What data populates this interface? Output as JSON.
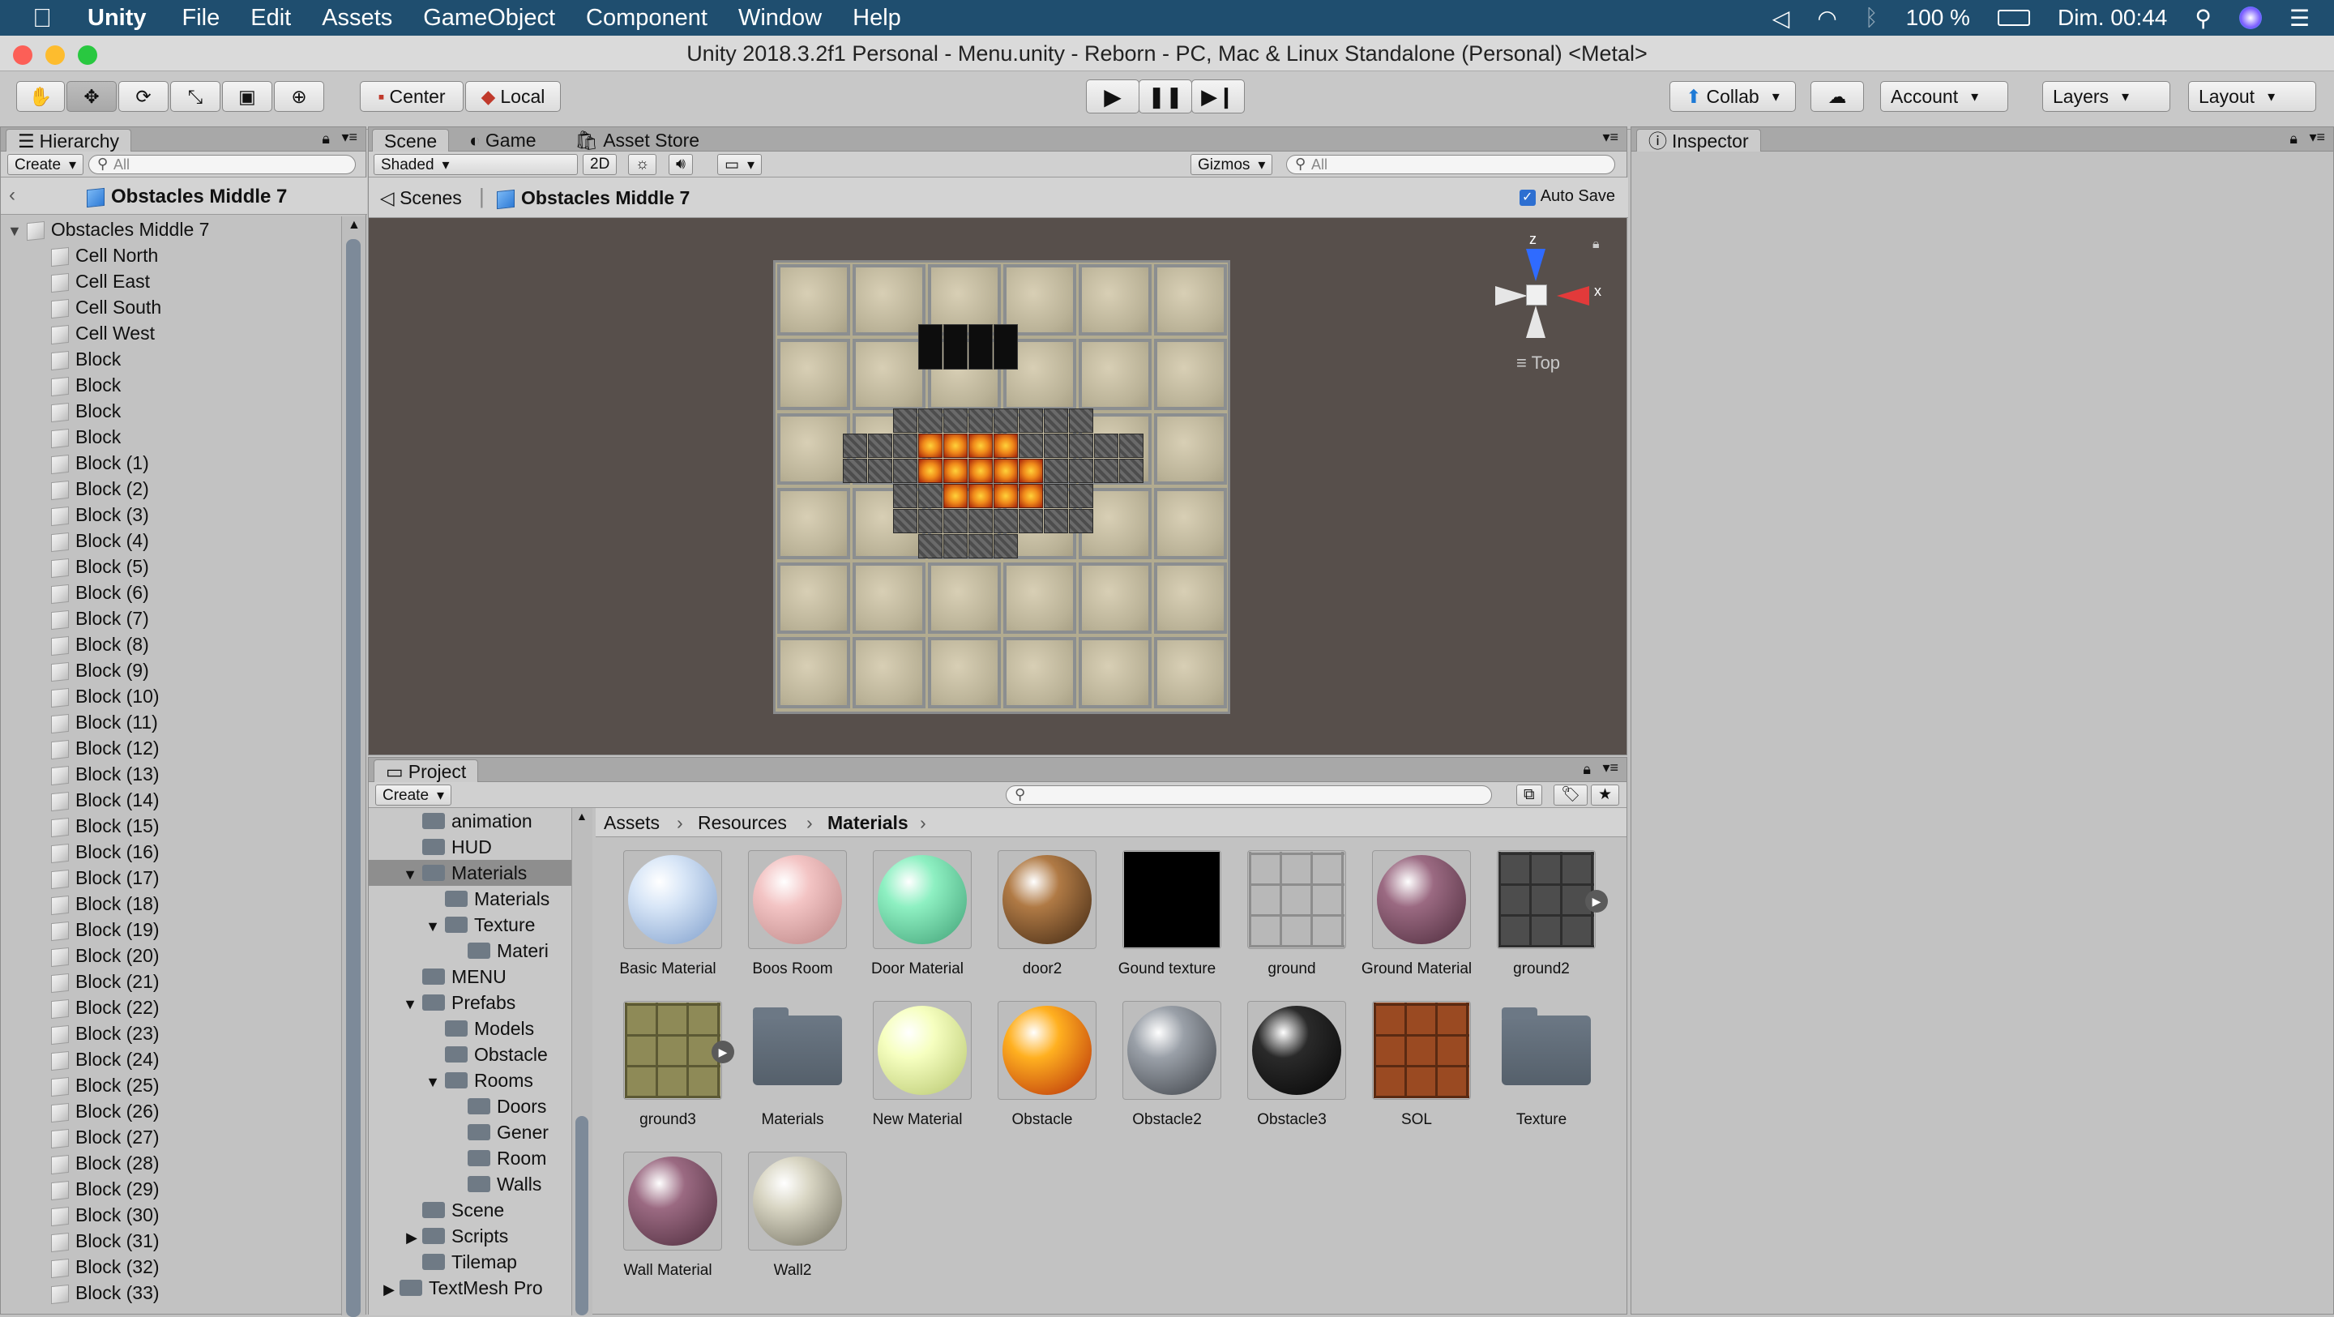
{
  "menubar": {
    "app": "Unity",
    "items": [
      "File",
      "Edit",
      "Assets",
      "GameObject",
      "Component",
      "Window",
      "Help"
    ],
    "battery": "100 %",
    "clock": "Dim. 00:44"
  },
  "window_title": "Unity 2018.3.2f1 Personal - Menu.unity - Reborn - PC, Mac & Linux Standalone (Personal) <Metal>",
  "toolbar": {
    "center": "Center",
    "local": "Local",
    "collab": "Collab",
    "account": "Account",
    "layers": "Layers",
    "layout": "Layout"
  },
  "hierarchy": {
    "tab": "Hierarchy",
    "create": "Create",
    "search_placeholder": "All",
    "breadcrumb": "Obstacles Middle 7",
    "root": "Obstacles Middle 7",
    "items": [
      "Cell North",
      "Cell East",
      "Cell South",
      "Cell West",
      "Block",
      "Block",
      "Block",
      "Block",
      "Block (1)",
      "Block (2)",
      "Block (3)",
      "Block (4)",
      "Block (5)",
      "Block (6)",
      "Block (7)",
      "Block (8)",
      "Block (9)",
      "Block (10)",
      "Block (11)",
      "Block (12)",
      "Block (13)",
      "Block (14)",
      "Block (15)",
      "Block (16)",
      "Block (17)",
      "Block (18)",
      "Block (19)",
      "Block (20)",
      "Block (21)",
      "Block (22)",
      "Block (23)",
      "Block (24)",
      "Block (25)",
      "Block (26)",
      "Block (27)",
      "Block (28)",
      "Block (29)",
      "Block (30)",
      "Block (31)",
      "Block (32)",
      "Block (33)"
    ]
  },
  "scene": {
    "tabs": [
      "Scene",
      "Game",
      "Asset Store"
    ],
    "shading": "Shaded",
    "mode2d": "2D",
    "gizmos": "Gizmos",
    "search_placeholder": "All",
    "breadcrumb_scenes": "Scenes",
    "breadcrumb_prefab": "Obstacles Middle 7",
    "autosave": "Auto Save",
    "gizmo_z": "z",
    "gizmo_x": "x",
    "view_label": "Top"
  },
  "inspector": {
    "tab": "Inspector"
  },
  "project": {
    "tab": "Project",
    "create": "Create",
    "path": [
      "Assets",
      "Resources",
      "Materials"
    ],
    "tree": [
      {
        "label": "animation",
        "indent": 1
      },
      {
        "label": "HUD",
        "indent": 1
      },
      {
        "label": "Materials",
        "indent": 1,
        "open": true,
        "selected": true
      },
      {
        "label": "Materials",
        "indent": 2
      },
      {
        "label": "Texture",
        "indent": 2,
        "open": true
      },
      {
        "label": "Materi",
        "indent": 3
      },
      {
        "label": "MENU",
        "indent": 1
      },
      {
        "label": "Prefabs",
        "indent": 1,
        "open": true
      },
      {
        "label": "Models",
        "indent": 2
      },
      {
        "label": "Obstacle",
        "indent": 2
      },
      {
        "label": "Rooms",
        "indent": 2,
        "open": true
      },
      {
        "label": "Doors",
        "indent": 3
      },
      {
        "label": "Gener",
        "indent": 3
      },
      {
        "label": "Room",
        "indent": 3
      },
      {
        "label": "Walls",
        "indent": 3
      },
      {
        "label": "Scene",
        "indent": 1
      },
      {
        "label": "Scripts",
        "indent": 1,
        "closed": true
      },
      {
        "label": "Tilemap",
        "indent": 1
      },
      {
        "label": "TextMesh Pro",
        "indent": 0,
        "closed": true
      }
    ],
    "assets": [
      {
        "label": "Basic Material",
        "kind": "sphere",
        "color": "#d8e6f7",
        "shade": "#7d9dcb"
      },
      {
        "label": "Boos Room",
        "kind": "sphere",
        "color": "#f3c4c4",
        "shade": "#b98383"
      },
      {
        "label": "Door Material",
        "kind": "sphere",
        "color": "#8ef0c2",
        "shade": "#3f9e74"
      },
      {
        "label": "door2",
        "kind": "sphere",
        "color": "#b07a45",
        "shade": "#3e2612"
      },
      {
        "label": "Gound texture",
        "kind": "square",
        "color": "#000000",
        "shade": "#000000"
      },
      {
        "label": "ground",
        "kind": "square",
        "color": "#b8b8b8",
        "shade": "#8d8d8d"
      },
      {
        "label": "Ground Material",
        "kind": "sphere",
        "color": "#9b6a82",
        "shade": "#4c2b3b"
      },
      {
        "label": "ground2",
        "kind": "square",
        "color": "#4d4d4d",
        "shade": "#2e2e2e",
        "badge": true
      },
      {
        "label": "ground3",
        "kind": "square",
        "color": "#8e8a57",
        "shade": "#5c5934",
        "badge": true
      },
      {
        "label": "Materials",
        "kind": "folder"
      },
      {
        "label": "New Material",
        "kind": "sphere",
        "color": "#f6ffc0",
        "shade": "#b5c46d"
      },
      {
        "label": "Obstacle",
        "kind": "sphere",
        "color": "#ffb020",
        "shade": "#b52a08"
      },
      {
        "label": "Obstacle2",
        "kind": "sphere",
        "color": "#9aa0a8",
        "shade": "#3a3e44"
      },
      {
        "label": "Obstacle3",
        "kind": "sphere",
        "color": "#2a2a2a",
        "shade": "#050505"
      },
      {
        "label": "SOL",
        "kind": "square",
        "color": "#9a4a22",
        "shade": "#5a2a12"
      },
      {
        "label": "Texture",
        "kind": "folder"
      },
      {
        "label": "Wall Material",
        "kind": "sphere",
        "color": "#9b6a82",
        "shade": "#4c2b3b"
      },
      {
        "label": "Wall2",
        "kind": "sphere",
        "color": "#d9d6c4",
        "shade": "#6f6c5d"
      }
    ]
  }
}
